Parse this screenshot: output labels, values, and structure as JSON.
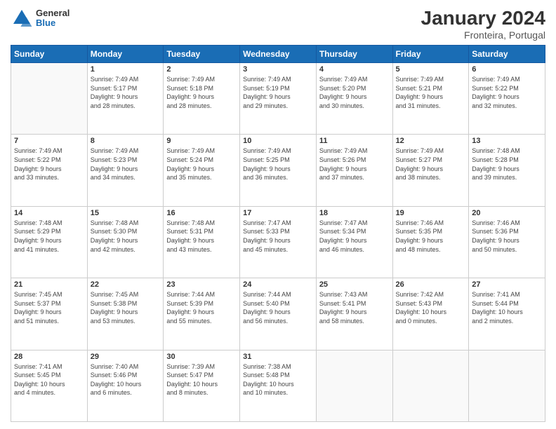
{
  "header": {
    "logo_line1": "General",
    "logo_line2": "Blue",
    "title": "January 2024",
    "subtitle": "Fronteira, Portugal"
  },
  "calendar": {
    "weekdays": [
      "Sunday",
      "Monday",
      "Tuesday",
      "Wednesday",
      "Thursday",
      "Friday",
      "Saturday"
    ],
    "weeks": [
      [
        {
          "day": "",
          "info": ""
        },
        {
          "day": "1",
          "info": "Sunrise: 7:49 AM\nSunset: 5:17 PM\nDaylight: 9 hours\nand 28 minutes."
        },
        {
          "day": "2",
          "info": "Sunrise: 7:49 AM\nSunset: 5:18 PM\nDaylight: 9 hours\nand 28 minutes."
        },
        {
          "day": "3",
          "info": "Sunrise: 7:49 AM\nSunset: 5:19 PM\nDaylight: 9 hours\nand 29 minutes."
        },
        {
          "day": "4",
          "info": "Sunrise: 7:49 AM\nSunset: 5:20 PM\nDaylight: 9 hours\nand 30 minutes."
        },
        {
          "day": "5",
          "info": "Sunrise: 7:49 AM\nSunset: 5:21 PM\nDaylight: 9 hours\nand 31 minutes."
        },
        {
          "day": "6",
          "info": "Sunrise: 7:49 AM\nSunset: 5:22 PM\nDaylight: 9 hours\nand 32 minutes."
        }
      ],
      [
        {
          "day": "7",
          "info": "Sunrise: 7:49 AM\nSunset: 5:22 PM\nDaylight: 9 hours\nand 33 minutes."
        },
        {
          "day": "8",
          "info": "Sunrise: 7:49 AM\nSunset: 5:23 PM\nDaylight: 9 hours\nand 34 minutes."
        },
        {
          "day": "9",
          "info": "Sunrise: 7:49 AM\nSunset: 5:24 PM\nDaylight: 9 hours\nand 35 minutes."
        },
        {
          "day": "10",
          "info": "Sunrise: 7:49 AM\nSunset: 5:25 PM\nDaylight: 9 hours\nand 36 minutes."
        },
        {
          "day": "11",
          "info": "Sunrise: 7:49 AM\nSunset: 5:26 PM\nDaylight: 9 hours\nand 37 minutes."
        },
        {
          "day": "12",
          "info": "Sunrise: 7:49 AM\nSunset: 5:27 PM\nDaylight: 9 hours\nand 38 minutes."
        },
        {
          "day": "13",
          "info": "Sunrise: 7:48 AM\nSunset: 5:28 PM\nDaylight: 9 hours\nand 39 minutes."
        }
      ],
      [
        {
          "day": "14",
          "info": "Sunrise: 7:48 AM\nSunset: 5:29 PM\nDaylight: 9 hours\nand 41 minutes."
        },
        {
          "day": "15",
          "info": "Sunrise: 7:48 AM\nSunset: 5:30 PM\nDaylight: 9 hours\nand 42 minutes."
        },
        {
          "day": "16",
          "info": "Sunrise: 7:48 AM\nSunset: 5:31 PM\nDaylight: 9 hours\nand 43 minutes."
        },
        {
          "day": "17",
          "info": "Sunrise: 7:47 AM\nSunset: 5:33 PM\nDaylight: 9 hours\nand 45 minutes."
        },
        {
          "day": "18",
          "info": "Sunrise: 7:47 AM\nSunset: 5:34 PM\nDaylight: 9 hours\nand 46 minutes."
        },
        {
          "day": "19",
          "info": "Sunrise: 7:46 AM\nSunset: 5:35 PM\nDaylight: 9 hours\nand 48 minutes."
        },
        {
          "day": "20",
          "info": "Sunrise: 7:46 AM\nSunset: 5:36 PM\nDaylight: 9 hours\nand 50 minutes."
        }
      ],
      [
        {
          "day": "21",
          "info": "Sunrise: 7:45 AM\nSunset: 5:37 PM\nDaylight: 9 hours\nand 51 minutes."
        },
        {
          "day": "22",
          "info": "Sunrise: 7:45 AM\nSunset: 5:38 PM\nDaylight: 9 hours\nand 53 minutes."
        },
        {
          "day": "23",
          "info": "Sunrise: 7:44 AM\nSunset: 5:39 PM\nDaylight: 9 hours\nand 55 minutes."
        },
        {
          "day": "24",
          "info": "Sunrise: 7:44 AM\nSunset: 5:40 PM\nDaylight: 9 hours\nand 56 minutes."
        },
        {
          "day": "25",
          "info": "Sunrise: 7:43 AM\nSunset: 5:41 PM\nDaylight: 9 hours\nand 58 minutes."
        },
        {
          "day": "26",
          "info": "Sunrise: 7:42 AM\nSunset: 5:43 PM\nDaylight: 10 hours\nand 0 minutes."
        },
        {
          "day": "27",
          "info": "Sunrise: 7:41 AM\nSunset: 5:44 PM\nDaylight: 10 hours\nand 2 minutes."
        }
      ],
      [
        {
          "day": "28",
          "info": "Sunrise: 7:41 AM\nSunset: 5:45 PM\nDaylight: 10 hours\nand 4 minutes."
        },
        {
          "day": "29",
          "info": "Sunrise: 7:40 AM\nSunset: 5:46 PM\nDaylight: 10 hours\nand 6 minutes."
        },
        {
          "day": "30",
          "info": "Sunrise: 7:39 AM\nSunset: 5:47 PM\nDaylight: 10 hours\nand 8 minutes."
        },
        {
          "day": "31",
          "info": "Sunrise: 7:38 AM\nSunset: 5:48 PM\nDaylight: 10 hours\nand 10 minutes."
        },
        {
          "day": "",
          "info": ""
        },
        {
          "day": "",
          "info": ""
        },
        {
          "day": "",
          "info": ""
        }
      ]
    ]
  }
}
